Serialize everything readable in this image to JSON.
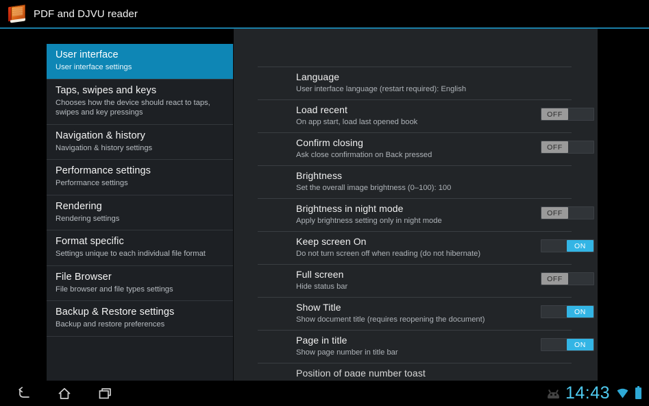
{
  "titlebar": {
    "app_title": "PDF and DJVU reader",
    "icon": "book-icon",
    "accent_color": "#1a7fa8"
  },
  "sidebar": {
    "items": [
      {
        "title": "User interface",
        "subtitle": "User interface settings",
        "selected": true
      },
      {
        "title": "Taps, swipes and keys",
        "subtitle": "Chooses how the device should react to taps, swipes and key pressings",
        "selected": false
      },
      {
        "title": "Navigation & history",
        "subtitle": "Navigation & history settings",
        "selected": false
      },
      {
        "title": "Performance settings",
        "subtitle": "Performance settings",
        "selected": false
      },
      {
        "title": "Rendering",
        "subtitle": "Rendering settings",
        "selected": false
      },
      {
        "title": "Format specific",
        "subtitle": "Settings unique to each individual file format",
        "selected": false
      },
      {
        "title": "File Browser",
        "subtitle": "File browser and file types settings",
        "selected": false
      },
      {
        "title": "Backup & Restore settings",
        "subtitle": "Backup and restore preferences",
        "selected": false
      }
    ],
    "selected_color": "#0e86b5"
  },
  "settings": {
    "rows": [
      {
        "title": "Language",
        "subtitle": "User interface language (restart required): English",
        "toggle": null
      },
      {
        "title": "Load recent",
        "subtitle": "On app start, load last opened book",
        "toggle": "OFF"
      },
      {
        "title": "Confirm closing",
        "subtitle": "Ask close confirmation on Back pressed",
        "toggle": "OFF"
      },
      {
        "title": "Brightness",
        "subtitle": "Set the overall image brightness (0–100): 100",
        "toggle": null
      },
      {
        "title": "Brightness in night mode",
        "subtitle": "Apply brightness setting only in night mode",
        "toggle": "OFF"
      },
      {
        "title": "Keep screen On",
        "subtitle": "Do not turn screen off when reading (do not hibernate)",
        "toggle": "ON"
      },
      {
        "title": "Full screen",
        "subtitle": "Hide status bar",
        "toggle": "OFF"
      },
      {
        "title": "Show Title",
        "subtitle": "Show document title (requires reopening the document)",
        "toggle": "ON"
      },
      {
        "title": "Page in title",
        "subtitle": "Show page number in title bar",
        "toggle": "ON"
      }
    ],
    "clipped_row": {
      "title": "Position of page number toast"
    },
    "toggle_on_color": "#33b5e5",
    "toggle_off_color": "#9a9a9a"
  },
  "systembar": {
    "nav": [
      {
        "name": "back-button",
        "icon": "back-arrow-icon"
      },
      {
        "name": "home-button",
        "icon": "home-icon"
      },
      {
        "name": "recents-button",
        "icon": "recent-apps-icon"
      }
    ],
    "clock": "14:43",
    "clock_color": "#4ec8ee",
    "status_icons": [
      "android-icon",
      "wifi-icon",
      "battery-icon"
    ]
  }
}
